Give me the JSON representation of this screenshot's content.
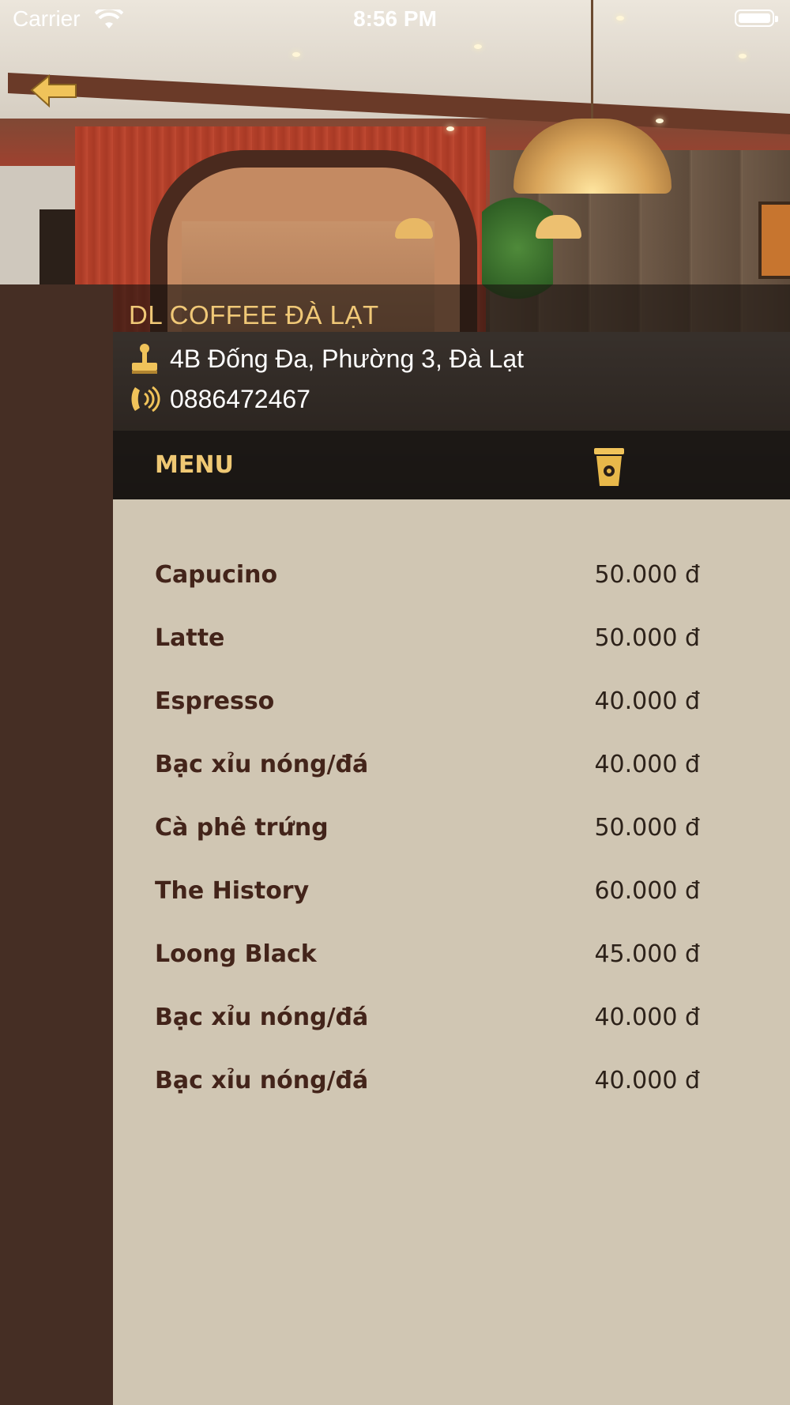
{
  "status_bar": {
    "carrier": "Carrier",
    "time": "8:56 PM"
  },
  "shop": {
    "name": "DL COFFEE ĐÀ LẠT",
    "address": "4B Đống Đa, Phường 3, Đà Lạt",
    "phone": "0886472467"
  },
  "menu": {
    "label": "MENU",
    "items": [
      {
        "name": "Capucino",
        "price": "50.000 đ"
      },
      {
        "name": "Latte",
        "price": "50.000 đ"
      },
      {
        "name": "Espresso",
        "price": "40.000 đ"
      },
      {
        "name": "Bạc xỉu nóng/đá",
        "price": "40.000 đ"
      },
      {
        "name": "Cà phê trứng",
        "price": "50.000 đ"
      },
      {
        "name": "The History",
        "price": "60.000 đ"
      },
      {
        "name": "Loong Black",
        "price": "45.000 đ"
      },
      {
        "name": "Bạc xỉu nóng/đá",
        "price": "40.000 đ"
      },
      {
        "name": "Bạc xỉu nóng/đá",
        "price": "40.000 đ"
      }
    ]
  },
  "colors": {
    "accent": "#f0c877",
    "sidebar": "#452e24",
    "list_bg": "#d0c6b3",
    "item_text": "#43241a"
  },
  "icons": {
    "back": "back-arrow-icon",
    "address": "joystick-location-icon",
    "phone": "phone-ringing-icon",
    "menu": "coffee-cup-icon"
  }
}
